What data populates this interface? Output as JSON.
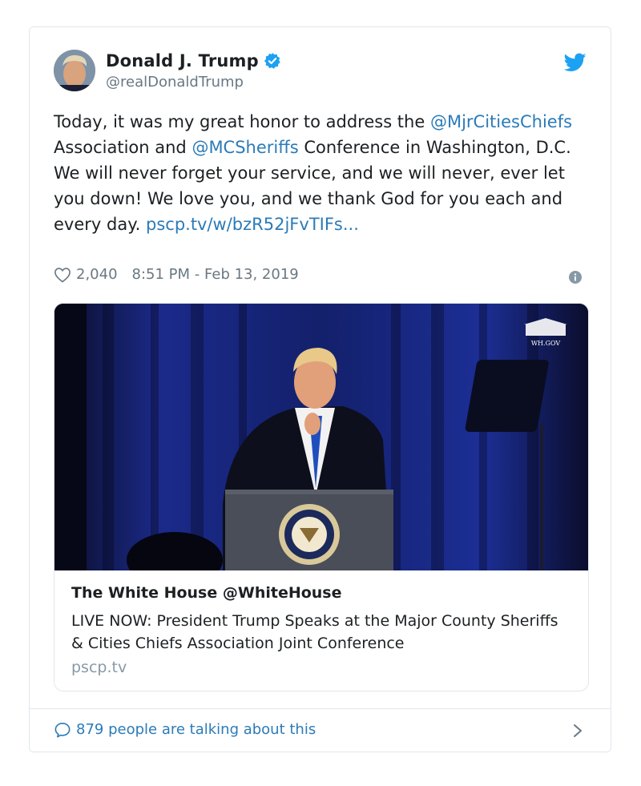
{
  "tweet": {
    "author_name": "Donald J. Trump",
    "handle": "@realDonaldTrump",
    "verified": true,
    "text_parts": {
      "p1": "Today, it was my great honor to address the ",
      "mention1": "@MjrCitiesChiefs",
      "p2": " Association and ",
      "mention2": "@MCSheriffs",
      "p3": " Conference in Washington, D.C. We will never forget your service, and we will never, ever let you down! We love you, and we thank God for you each and every day. ",
      "link": "pscp.tv/w/bzR52jFvTIFs..."
    },
    "likes": "2,040",
    "timestamp": "8:51 PM - Feb 13, 2019"
  },
  "media_card": {
    "watermark": "WH.GOV",
    "title": "The White House @WhiteHouse",
    "description": "LIVE NOW: President Trump Speaks at the Major County Sheriffs & Cities Chiefs Association Joint Conference",
    "domain": "pscp.tv"
  },
  "footer": {
    "talking": "879 people are talking about this"
  },
  "icons": {
    "verified": "verified-badge-icon",
    "bird": "twitter-bird-icon",
    "heart": "heart-icon",
    "info": "info-icon",
    "bubble": "speech-bubble-icon",
    "chevron": "chevron-right-icon"
  },
  "colors": {
    "link": "#2b7bb9",
    "muted": "#697882",
    "border": "#e1e8ed",
    "twitter_blue": "#1da1f2"
  }
}
